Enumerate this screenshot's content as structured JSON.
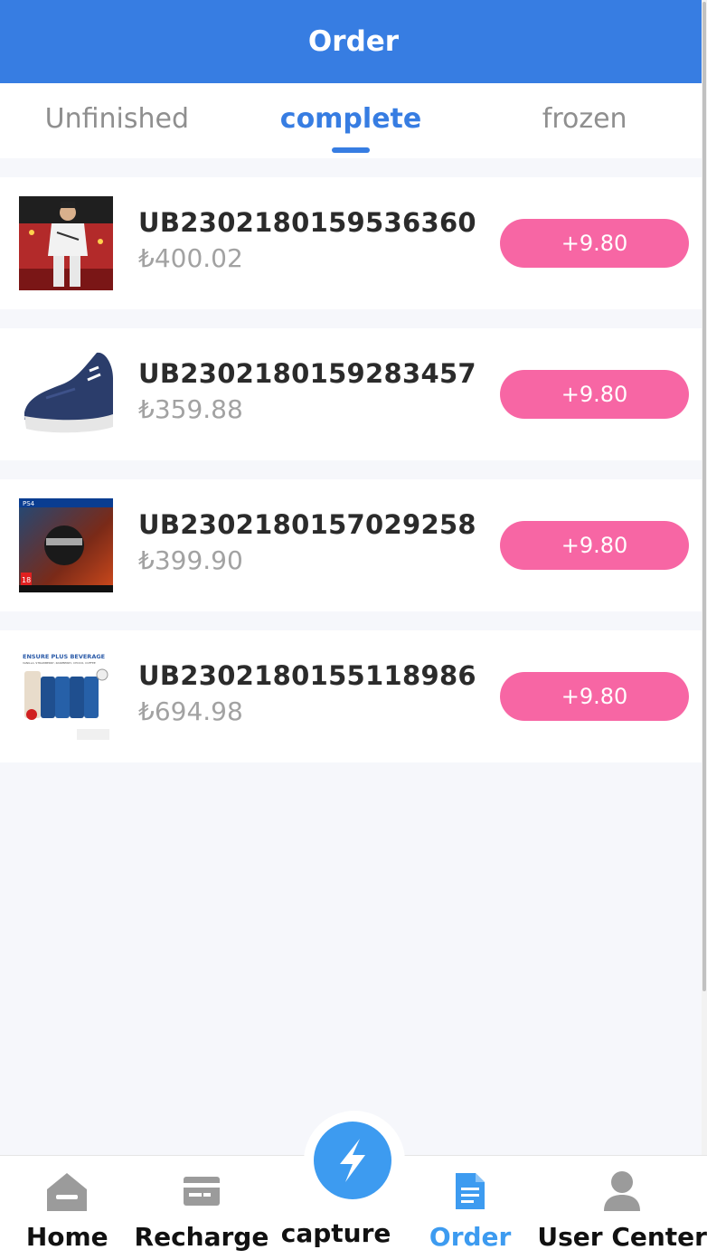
{
  "header": {
    "title": "Order"
  },
  "tabs": [
    {
      "label": "Unfinished",
      "active": false
    },
    {
      "label": "complete",
      "active": true
    },
    {
      "label": "frozen",
      "active": false
    }
  ],
  "orders": [
    {
      "id": "UB2302180159536360",
      "price": "₺400.02",
      "reward": "+9.80",
      "thumbnail": "person-photo"
    },
    {
      "id": "UB2302180159283457",
      "price": "₺359.88",
      "reward": "+9.80",
      "thumbnail": "sneaker-photo"
    },
    {
      "id": "UB2302180157029258",
      "price": "₺399.90",
      "reward": "+9.80",
      "thumbnail": "game-cover"
    },
    {
      "id": "UB2302180155118986",
      "price": "₺694.98",
      "reward": "+9.80",
      "thumbnail": "beverage-pack"
    }
  ],
  "tabbar": {
    "home": "Home",
    "recharge": "Recharge",
    "capture": "capture",
    "order": "Order",
    "user_center": "User Center"
  },
  "thumb_labels": {
    "ps4": "PS4",
    "age_rating": "18",
    "beverage_title": "ENSURE PLUS BEVERAGE",
    "beverage_subtitle": "VANILLA, STRAWBERRY, RASPBERRY, CHOCO, COFFEE"
  },
  "colors": {
    "primary": "#377de2",
    "reward": "#f766a4",
    "active_tab_icon": "#3d9bf0"
  }
}
